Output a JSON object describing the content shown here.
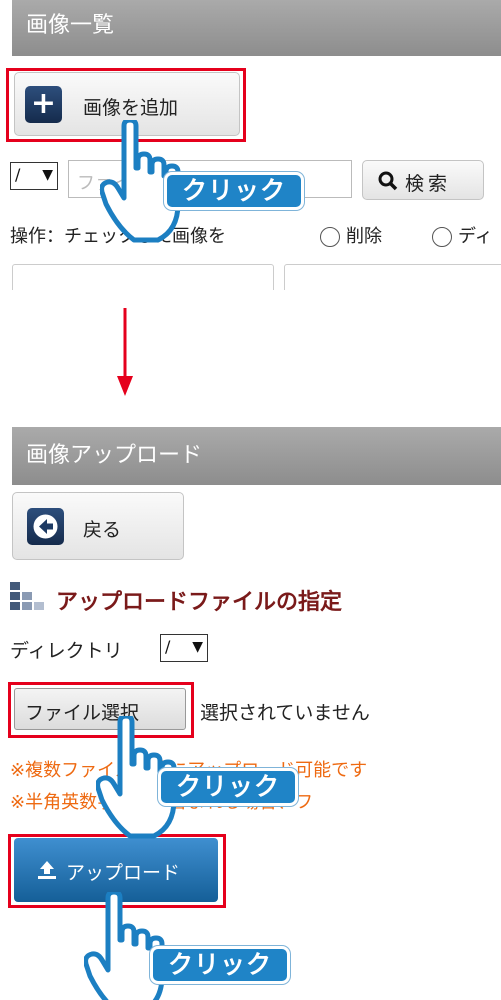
{
  "top_screen": {
    "title": "画像一覧",
    "add_button_label": "画像を追加",
    "add_icon": "plus-icon",
    "dir_select_value": "/",
    "search_placeholder": "ファイル名",
    "search_button_label": "検索",
    "operation_label": "操作：チェックした画像を",
    "radio_delete_label": "削除",
    "radio_dir_label": "ディ"
  },
  "bottom_screen": {
    "title": "画像アップロード",
    "back_button_label": "戻る",
    "back_icon": "arrow-left-circle-icon",
    "section_title": "アップロードファイルの指定",
    "section_icon": "bar-blocks-icon",
    "directory_label": "ディレクトリ",
    "directory_value": "/",
    "file_button_label": "ファイル選択",
    "file_status": "選択されていません",
    "note1": "※複数ファイル同時にアップロード可能です",
    "note2": "※半角英数字以外が含まれる場合、フ",
    "upload_button_label": "アップロード",
    "upload_icon": "upload-icon"
  },
  "annotations": {
    "click_label": "クリック"
  },
  "colors": {
    "highlight_red": "#e5001c",
    "arrow_red": "#e5001c",
    "click_blue": "#1f84c7",
    "upload_blue": "#1f6fab",
    "note_orange": "#ee6a12",
    "section_title": "#7a1a1a"
  }
}
